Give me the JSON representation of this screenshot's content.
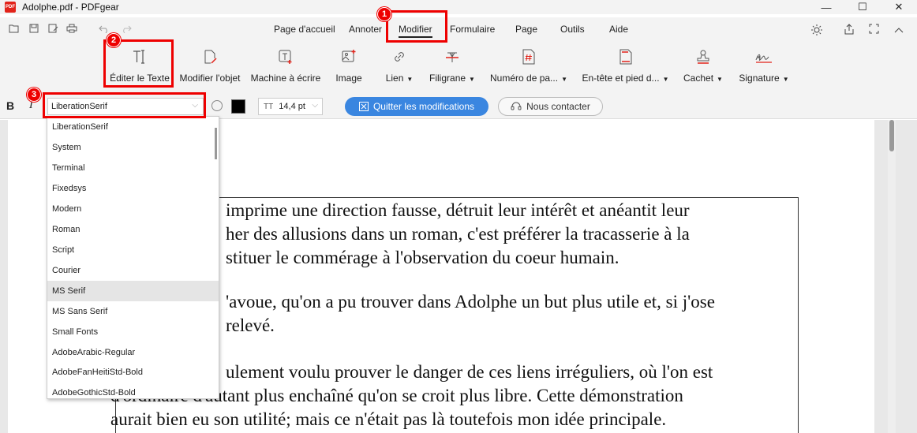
{
  "window": {
    "title": "Adolphe.pdf - PDFgear",
    "logo_text": "PDF",
    "controls": [
      "—",
      "☐",
      "✕"
    ]
  },
  "quick_access": [
    "open-icon",
    "save-icon",
    "save-as-icon",
    "print-icon",
    "undo-icon",
    "redo-icon"
  ],
  "menu": {
    "tabs": [
      "Page d'accueil",
      "Annoter",
      "Modifier",
      "Formulaire",
      "Page",
      "Outils",
      "Aide"
    ],
    "active": "Modifier"
  },
  "ribbon": {
    "items": [
      {
        "label": "Éditer le Texte",
        "icon": "edit-text-icon"
      },
      {
        "label": "Modifier l'objet",
        "icon": "edit-object-icon"
      },
      {
        "label": "Machine à écrire",
        "icon": "typewriter-icon"
      },
      {
        "label": "Image",
        "icon": "image-icon"
      },
      {
        "label": "Lien",
        "icon": "link-icon",
        "dropdown": true
      },
      {
        "label": "Filigrane",
        "icon": "watermark-icon",
        "dropdown": true
      },
      {
        "label": "Numéro de pa...",
        "icon": "page-number-icon",
        "dropdown": true
      },
      {
        "label": "En-tête et pied d...",
        "icon": "header-footer-icon",
        "dropdown": true
      },
      {
        "label": "Cachet",
        "icon": "stamp-icon",
        "dropdown": true
      },
      {
        "label": "Signature",
        "icon": "signature-icon",
        "dropdown": true
      }
    ]
  },
  "format_bar": {
    "bold": "B",
    "italic": "I",
    "font_value": "LiberationSerif",
    "size_value": "14,4 pt",
    "size_icon_text": "TT",
    "text_color": "#000000",
    "quit_button": "Quitter les modifications",
    "contact_button": "Nous contacter"
  },
  "font_dropdown": {
    "items": [
      "LiberationSerif",
      "System",
      "Terminal",
      "Fixedsys",
      "Modern",
      "Roman",
      "Script",
      "Courier",
      "MS Serif",
      "MS Sans Serif",
      "Small Fonts",
      "AdobeArabic-Regular",
      "AdobeFanHeitiStd-Bold",
      "AdobeGothicStd-Bold"
    ],
    "highlighted": "MS Serif"
  },
  "document": {
    "lines": [
      "imprime une direction fausse, détruit leur intérêt et anéantit leur",
      "her des allusions dans un roman, c'est préférer la tracasserie à la",
      "stituer le commérage à l'observation du coeur humain.",
      "'avoue, qu'on a pu trouver dans Adolphe un but plus utile et, si j'ose",
      "relevé.",
      "ulement voulu prouver le danger de ces liens irréguliers, où l'on est",
      "d'ordinaire d'autant plus enchaîné qu'on se croit plus libre. Cette démonstration",
      "aurait bien eu son utilité; mais ce n'était pas là toutefois mon idée principale."
    ]
  },
  "annotations": {
    "badges": [
      "1",
      "2",
      "3"
    ],
    "color": "#e00000"
  },
  "colors": {
    "accent_blue": "#3a86e0",
    "highlight": "#e5e5e5"
  }
}
